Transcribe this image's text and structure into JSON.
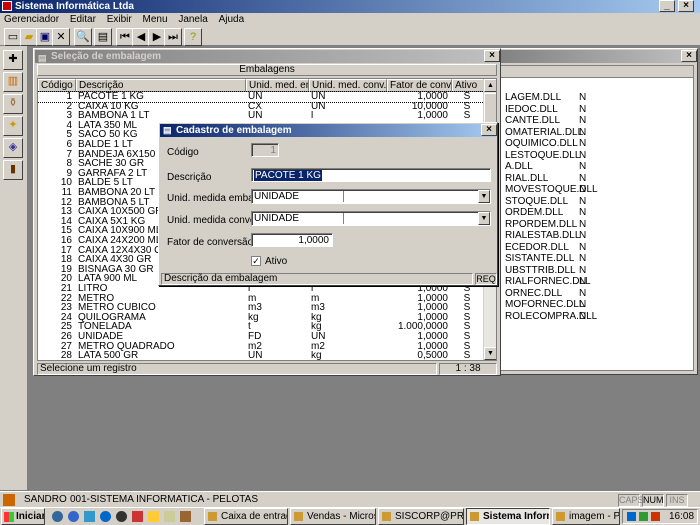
{
  "app": {
    "title": "Sistema Informática Ltda"
  },
  "menu": [
    "Gerenciador",
    "Editar",
    "Exibir",
    "Menu",
    "Janela",
    "Ajuda"
  ],
  "toolbar": {
    "icons": [
      "new-icon",
      "open-icon",
      "save-icon",
      "close-icon",
      "search-icon",
      "print-icon",
      "first-icon",
      "prev-icon",
      "next-icon",
      "last-icon",
      "help-icon"
    ]
  },
  "embalagem_window": {
    "title": "Seleção de embalagem",
    "group_header": "Embalagens",
    "columns": [
      "Código",
      "Descrição",
      "Unid. med. emb.",
      "Unid. med. conv.",
      "Fator de conversão",
      "Ativo"
    ],
    "rows": [
      {
        "codigo": "1",
        "descricao": "PACOTE 1 KG",
        "emb": "UN",
        "conv": "UN",
        "fator": "1,0000",
        "ativo": "S"
      },
      {
        "codigo": "2",
        "descricao": "CAIXA 10 KG",
        "emb": "CX",
        "conv": "UN",
        "fator": "10,0000",
        "ativo": "S"
      },
      {
        "codigo": "3",
        "descricao": "BAMBONA 1 LT",
        "emb": "UN",
        "conv": "l",
        "fator": "1,0000",
        "ativo": "S"
      },
      {
        "codigo": "4",
        "descricao": "LATA 350 ML",
        "emb": "",
        "conv": "",
        "fator": "",
        "ativo": ""
      },
      {
        "codigo": "5",
        "descricao": "SACO 50 KG",
        "emb": "",
        "conv": "",
        "fator": "",
        "ativo": ""
      },
      {
        "codigo": "6",
        "descricao": "BALDE 1 LT",
        "emb": "",
        "conv": "",
        "fator": "",
        "ativo": ""
      },
      {
        "codigo": "7",
        "descricao": "BANDEJA 6X150 ML",
        "emb": "",
        "conv": "",
        "fator": "",
        "ativo": ""
      },
      {
        "codigo": "8",
        "descricao": "SACHE 30 GR",
        "emb": "",
        "conv": "",
        "fator": "",
        "ativo": ""
      },
      {
        "codigo": "9",
        "descricao": "GARRAFA 2 LT",
        "emb": "",
        "conv": "",
        "fator": "",
        "ativo": ""
      },
      {
        "codigo": "10",
        "descricao": "BALDE 5 LT",
        "emb": "",
        "conv": "",
        "fator": "",
        "ativo": ""
      },
      {
        "codigo": "11",
        "descricao": "BAMBONA 20 LT",
        "emb": "",
        "conv": "",
        "fator": "",
        "ativo": ""
      },
      {
        "codigo": "12",
        "descricao": "BAMBONA 5 LT",
        "emb": "",
        "conv": "",
        "fator": "",
        "ativo": ""
      },
      {
        "codigo": "13",
        "descricao": "CAIXA 10X500 GR",
        "emb": "",
        "conv": "",
        "fator": "",
        "ativo": ""
      },
      {
        "codigo": "14",
        "descricao": "CAIXA 5X1 KG",
        "emb": "",
        "conv": "",
        "fator": "",
        "ativo": ""
      },
      {
        "codigo": "15",
        "descricao": "CAIXA 10X900 ML",
        "emb": "",
        "conv": "",
        "fator": "",
        "ativo": ""
      },
      {
        "codigo": "16",
        "descricao": "CAIXA 24X200 ML",
        "emb": "",
        "conv": "",
        "fator": "",
        "ativo": ""
      },
      {
        "codigo": "17",
        "descricao": "CAIXA 12X4X30 GR",
        "emb": "",
        "conv": "",
        "fator": "",
        "ativo": ""
      },
      {
        "codigo": "18",
        "descricao": "CAIXA 4X30 GR",
        "emb": "",
        "conv": "",
        "fator": "",
        "ativo": ""
      },
      {
        "codigo": "19",
        "descricao": "BISNAGA 30 GR",
        "emb": "",
        "conv": "",
        "fator": "",
        "ativo": ""
      },
      {
        "codigo": "20",
        "descricao": "LATA 900 ML",
        "emb": "",
        "conv": "",
        "fator": "",
        "ativo": ""
      },
      {
        "codigo": "21",
        "descricao": "LITRO",
        "emb": "l",
        "conv": "l",
        "fator": "1,0000",
        "ativo": "S"
      },
      {
        "codigo": "22",
        "descricao": "METRO",
        "emb": "m",
        "conv": "m",
        "fator": "1,0000",
        "ativo": "S"
      },
      {
        "codigo": "23",
        "descricao": "METRO CÚBICO",
        "emb": "m3",
        "conv": "m3",
        "fator": "1,0000",
        "ativo": "S"
      },
      {
        "codigo": "24",
        "descricao": "QUILOGRAMA",
        "emb": "kg",
        "conv": "kg",
        "fator": "1,0000",
        "ativo": "S"
      },
      {
        "codigo": "25",
        "descricao": "TONELADA",
        "emb": "t",
        "conv": "kg",
        "fator": "1.000,0000",
        "ativo": "S"
      },
      {
        "codigo": "26",
        "descricao": "UNIDADE",
        "emb": "FD",
        "conv": "UN",
        "fator": "1,0000",
        "ativo": "S"
      },
      {
        "codigo": "27",
        "descricao": "METRO QUADRADO",
        "emb": "m2",
        "conv": "m2",
        "fator": "1,0000",
        "ativo": "S"
      },
      {
        "codigo": "28",
        "descricao": "LATA 500 GR",
        "emb": "UN",
        "conv": "kg",
        "fator": "0,5000",
        "ativo": "S"
      }
    ],
    "status_left": "Selecione um registro",
    "status_right": "1 : 38"
  },
  "back_window": {
    "items": [
      {
        "name": "LAGEM.DLL",
        "flag": "N"
      },
      {
        "name": "IEDOC.DLL",
        "flag": "N"
      },
      {
        "name": "CANTE.DLL",
        "flag": "N"
      },
      {
        "name": "OMATERIAL.DLL",
        "flag": "N"
      },
      {
        "name": "OQUIMICO.DLL",
        "flag": "N"
      },
      {
        "name": "LESTOQUE.DLL",
        "flag": "N"
      },
      {
        "name": "A.DLL",
        "flag": "N"
      },
      {
        "name": "RIAL.DLL",
        "flag": "N"
      },
      {
        "name": "MOVESTOQUE.DLL",
        "flag": "N"
      },
      {
        "name": "STOQUE.DLL",
        "flag": "N"
      },
      {
        "name": "ORDEM.DLL",
        "flag": "N"
      },
      {
        "name": "RPORDEM.DLL",
        "flag": "N"
      },
      {
        "name": "RIALESTAB.DLL",
        "flag": "N"
      },
      {
        "name": "ECEDOR.DLL",
        "flag": "N"
      },
      {
        "name": "SISTANTE.DLL",
        "flag": "N"
      },
      {
        "name": "UBSTTRIB.DLL",
        "flag": "N"
      },
      {
        "name": "RIALFORNEC.DLL",
        "flag": "N"
      },
      {
        "name": "ORNEC.DLL",
        "flag": "N"
      },
      {
        "name": "MOFORNEC.DLL",
        "flag": "N"
      },
      {
        "name": "ROLECOMPRA.DLL",
        "flag": "N"
      }
    ]
  },
  "dialog": {
    "title": "Cadastro de embalagem",
    "codigo_label": "Código",
    "codigo_value": "1",
    "descricao_label": "Descrição",
    "descricao_value": "PACOTE 1 KG",
    "emb_label": "Unid. medida embalagem",
    "emb_value": "UNIDADE",
    "conv_label": "Unid. medida conversão",
    "conv_value": "UNIDADE",
    "fator_label": "Fator de conversão",
    "fator_value": "1,0000",
    "ativo_label": "Ativo",
    "ativo_checked": true,
    "status_left": "Descrição da embalagem",
    "status_right": "REQ"
  },
  "statusbar": {
    "user": "SANDRO",
    "company": "001-SISTEMA INFORMATICA - PELOTAS",
    "caps": "CAPS",
    "num": "NUM",
    "ins": "INS"
  },
  "taskbar": {
    "start": "Iniciar",
    "tasks": [
      "Caixa de entrada...",
      "Vendas - Microsof...",
      "SISCORP@PRD/...",
      "Sistema Inform...",
      "imagem - Paint"
    ],
    "active_task": 3,
    "clock": "16:08"
  }
}
